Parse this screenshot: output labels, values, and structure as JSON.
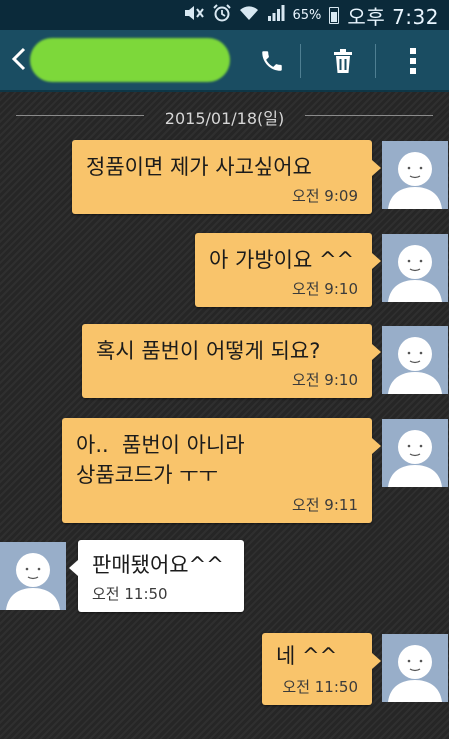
{
  "status_bar": {
    "battery_percent": "65%",
    "time": "오후 7:32",
    "icons": [
      "mute-icon",
      "alarm-icon",
      "wifi-icon",
      "signal-icon",
      "battery-icon"
    ]
  },
  "action_bar": {
    "contact_name": "",
    "icons": [
      "back-icon",
      "phone-icon",
      "trash-icon",
      "overflow-menu-icon"
    ]
  },
  "date_separator": "2015/01/18(일)",
  "colors": {
    "sent_bubble": "#f9c46b",
    "received_bubble": "#ffffff",
    "action_bar": "#1a4d62",
    "status_bar": "#0b2a3a",
    "avatar_bg": "#98aec9",
    "contact_highlight": "#7dd83a"
  },
  "messages": [
    {
      "direction": "sent",
      "text": "정품이면 제가 사고싶어요",
      "time": "오전 9:09"
    },
    {
      "direction": "sent",
      "text": "아 가방이요 ^^",
      "time": "오전 9:10"
    },
    {
      "direction": "sent",
      "text": "혹시 품번이 어떻게 되요?",
      "time": "오전 9:10"
    },
    {
      "direction": "sent",
      "text": "아..  품번이 아니라\n상품코드가 ㅜㅜ",
      "time": "오전 9:11"
    },
    {
      "direction": "received",
      "text": "판매됐어요^^",
      "time": "오전 11:50"
    },
    {
      "direction": "sent",
      "text": "네 ^^",
      "time": "오전 11:50"
    }
  ]
}
